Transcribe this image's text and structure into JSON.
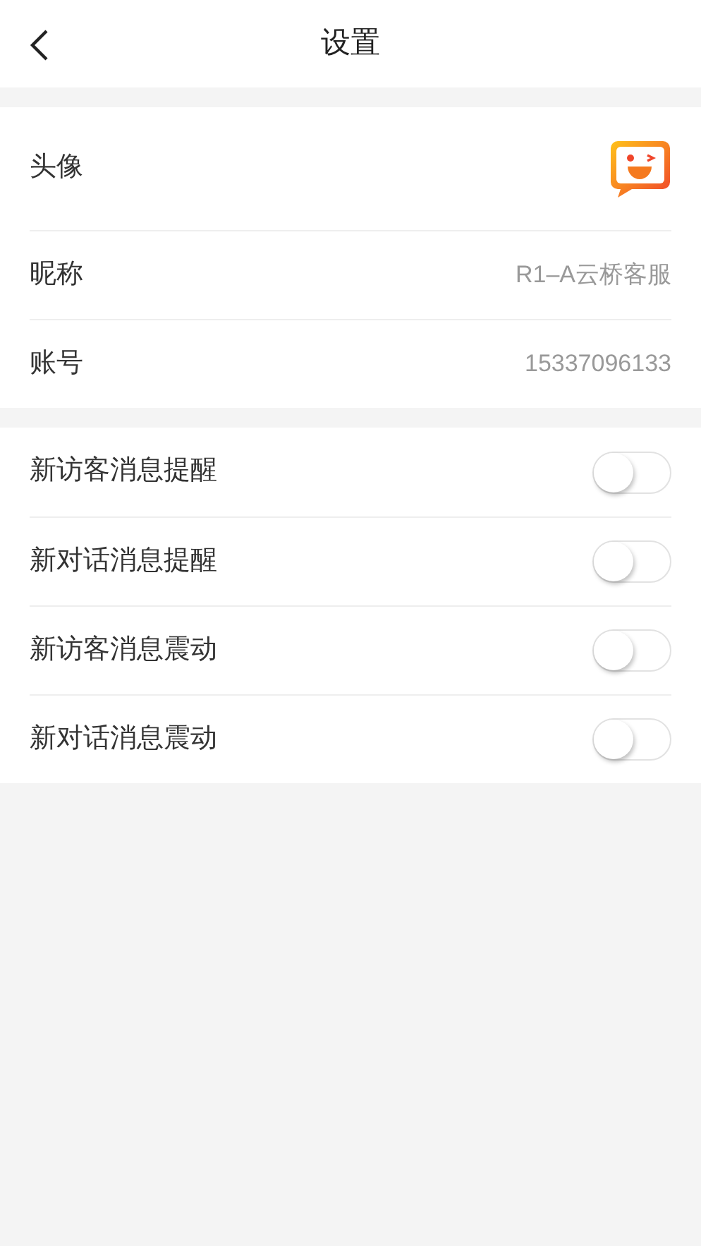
{
  "header": {
    "title": "设置"
  },
  "profile": [
    {
      "kind": "avatar",
      "label": "头像"
    },
    {
      "kind": "text",
      "label": "昵称",
      "value": "R1–A云桥客服"
    },
    {
      "kind": "text",
      "label": "账号",
      "value": "15337096133"
    }
  ],
  "toggles": [
    {
      "label": "新访客消息提醒",
      "on": false
    },
    {
      "label": "新对话消息提醒",
      "on": false
    },
    {
      "label": "新访客消息震动",
      "on": false
    },
    {
      "label": "新对话消息震动",
      "on": false
    }
  ]
}
